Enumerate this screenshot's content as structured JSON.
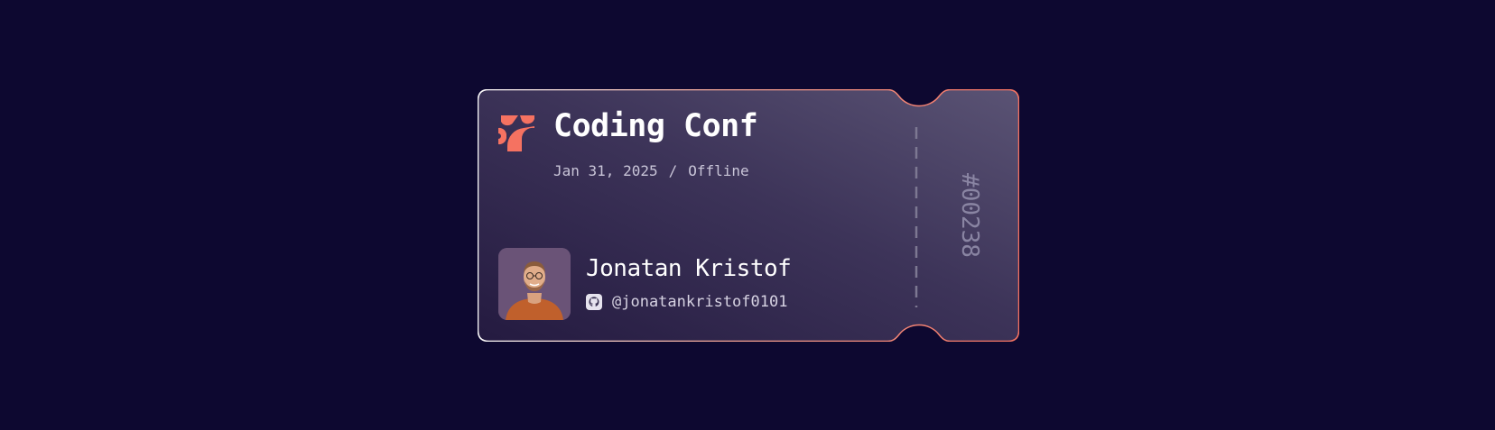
{
  "ticket": {
    "logo_icon": "coding-conf-logo-icon",
    "title": "Coding Conf",
    "date": "Jan 31, 2025",
    "separator": "/",
    "location": "Offline",
    "attendee": {
      "name": "Jonatan Kristof",
      "github_icon": "github-icon",
      "github_handle": "@jonatankristof0101"
    },
    "ticket_number": "#00238"
  },
  "colors": {
    "page_background": "#0d0830",
    "accent": "#f57261",
    "ticket_border": "#f57261",
    "ticket_fill_start": "#2a2048",
    "ticket_fill_end": "#554d6e"
  }
}
